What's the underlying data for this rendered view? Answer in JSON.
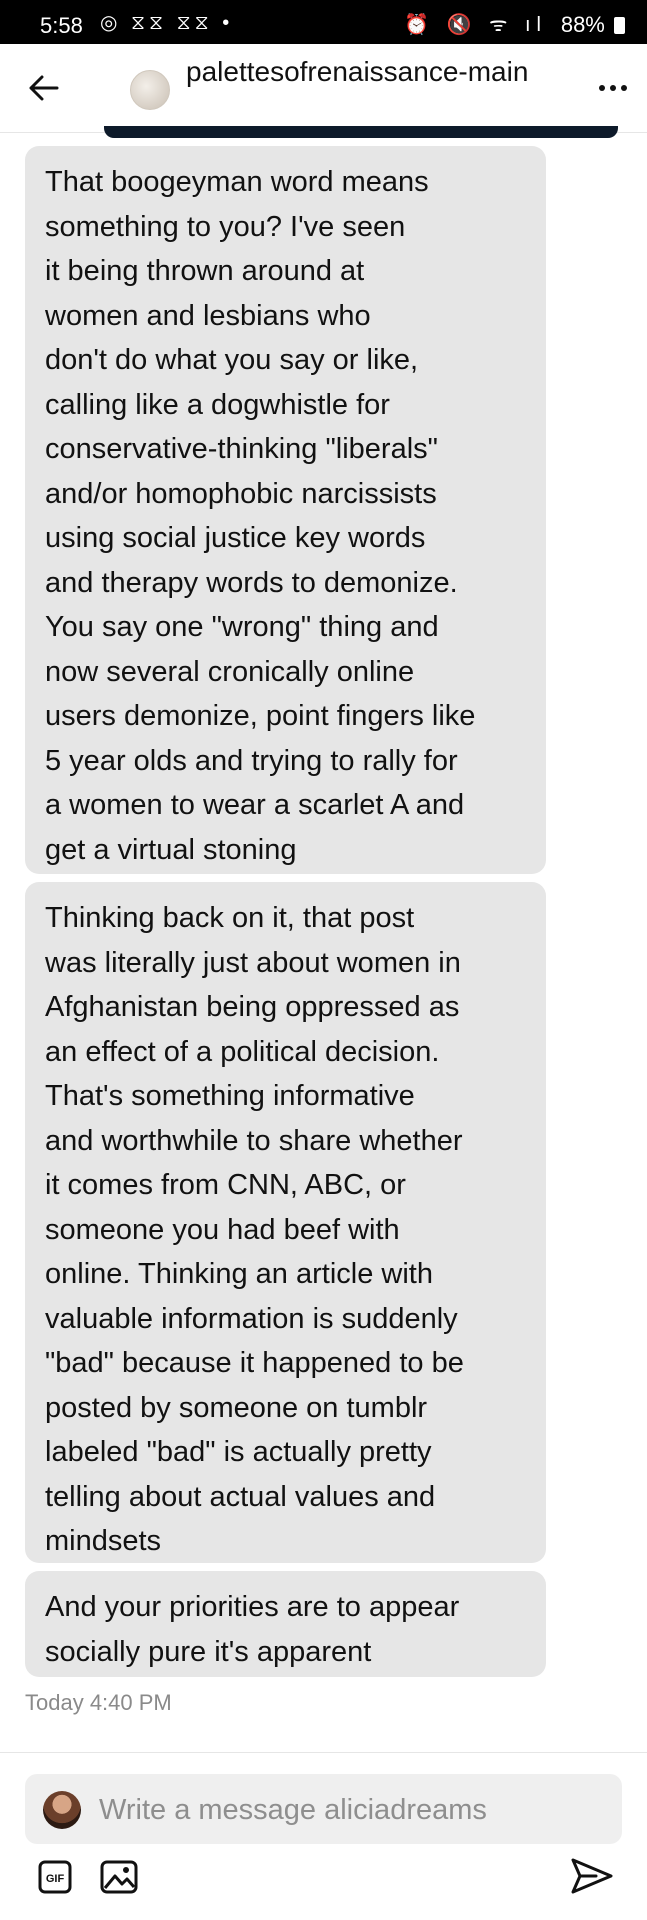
{
  "status_bar": {
    "time": "5:58",
    "left_icons": "◎ ⧖⧖ ⧖⧖ •",
    "right_icons": "⏰ 🔇 ᯤ ıl",
    "battery": "88%"
  },
  "header": {
    "blog_name": "palettesofrenaissance-main",
    "back_icon": "arrow-left-icon",
    "more_icon": "more-horizontal-icon"
  },
  "messages": [
    {
      "text": "That boogeyman word means\nsomething to you? I've seen\nit being thrown around at\nwomen and lesbians who\ndon't do what you say or like,\ncalling like a dogwhistle for\nconservative-thinking \"liberals\"\nand/or homophobic narcissists\nusing social justice key words\nand therapy words to demonize.\nYou say one \"wrong\" thing and\nnow several cronically online\nusers demonize, point fingers like\n5 year olds and trying to rally for\na women to wear a scarlet A and\nget a virtual stoning"
    },
    {
      "text": "Thinking back on it, that post\nwas literally just about women in\nAfghanistan being oppressed as\nan effect of a political decision.\nThat's something informative\nand worthwhile to share whether\nit comes from CNN, ABC, or\nsomeone you had beef with\nonline. Thinking an article with\nvaluable information is suddenly\n\"bad\" because it happened to be\nposted by someone on tumblr\nlabeled \"bad\" is actually pretty\ntelling about actual values and\nmindsets"
    },
    {
      "text": "And your priorities are to appear\nsocially pure it's apparent"
    }
  ],
  "timestamp": "Today 4:40 PM",
  "composer": {
    "placeholder": "Write a message aliciadreams",
    "value": ""
  },
  "toolbar": {
    "gif_label": "GIF",
    "image_icon": "image-icon",
    "send_icon": "send-icon"
  },
  "colors": {
    "bubble_bg": "#e6e6e6",
    "status_bar_bg": "#000000",
    "timestamp": "#8a8a8a"
  }
}
